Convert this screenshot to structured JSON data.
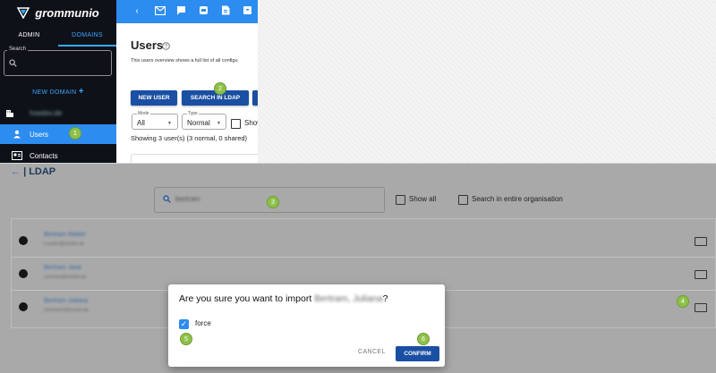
{
  "app": {
    "name": "grommunio"
  },
  "sidebar": {
    "tabs": [
      {
        "label": "ADMIN"
      },
      {
        "label": "DOMAINS"
      }
    ],
    "search_label": "Search",
    "new_domain": "NEW DOMAIN",
    "domain_name": "hsedev.de",
    "items": [
      {
        "label": "Users"
      },
      {
        "label": "Contacts"
      }
    ]
  },
  "main": {
    "title": "Users",
    "description": "This users overview shows a full list of all configu",
    "buttons": {
      "new_user": "NEW USER",
      "search_ldap": "SEARCH IN LDAP"
    },
    "mode": {
      "label": "Mode",
      "value": "All"
    },
    "type": {
      "label": "Type",
      "value": "Normal"
    },
    "show_label": "Show",
    "showing": "Showing 3 user(s) (3 normal, 0 shared)"
  },
  "ldap": {
    "title": "| LDAP",
    "search_value": "bertram",
    "show_all": "Show all",
    "search_org": "Search in entire organisation",
    "rows": [
      {
        "name": "Bertram Walter",
        "email": "b.walter@hsedev.de"
      },
      {
        "name": "Bertram Jane",
        "email": "j.bertram@hsedev.de"
      },
      {
        "name": "Bertram Juliana",
        "email": "j.bertram2@hsedev.de"
      }
    ]
  },
  "dialog": {
    "title_prefix": "Are you sure you want to import ",
    "title_name": "Bertram, Juliana",
    "title_suffix": "?",
    "force_label": "force",
    "cancel": "CANCEL",
    "confirm": "CONFIRM"
  },
  "markers": [
    "1",
    "2",
    "3",
    "4",
    "5",
    "6"
  ],
  "colors": {
    "accent": "#2d8cf0",
    "primary_button": "#1a4fa3",
    "sidebar": "#0e1118",
    "marker": "#8fc14a"
  }
}
